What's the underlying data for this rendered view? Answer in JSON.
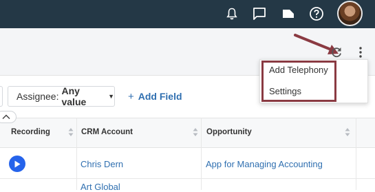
{
  "topbar": {
    "icons": [
      "bell-icon",
      "chat-icon",
      "folder-icon",
      "help-icon"
    ],
    "avatar": "user-avatar"
  },
  "toolbar": {
    "icons": [
      "refresh-icon",
      "more-vert-icon"
    ]
  },
  "menu": {
    "items": [
      "Add Telephony",
      "Settings"
    ]
  },
  "filters": {
    "assignee_label": "Assignee:",
    "assignee_value": "Any value",
    "add_field": "Add Field"
  },
  "table": {
    "columns": [
      "Recording",
      "CRM Account",
      "Opportunity"
    ],
    "rows": [
      {
        "crm_account": "Chris Dern",
        "opportunity": "App for Managing Accounting"
      },
      {
        "crm_account": "Art Global",
        "opportunity": ""
      }
    ]
  },
  "colors": {
    "topbar": "#243846",
    "link": "#2f6fb0",
    "play": "#2563eb",
    "annotation": "#8a3a42"
  }
}
